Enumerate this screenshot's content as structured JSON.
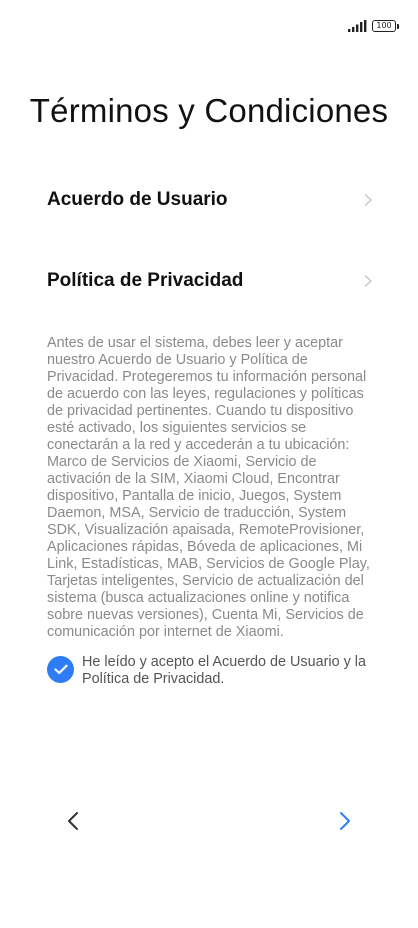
{
  "status_bar": {
    "signal_icon": "signal-bars-icon",
    "battery_level": "100",
    "battery_icon": "battery-icon"
  },
  "page": {
    "title": "Términos y Condiciones"
  },
  "links": [
    {
      "label": "Acuerdo de Usuario",
      "icon": "chevron-right-icon"
    },
    {
      "label": "Política de Privacidad",
      "icon": "chevron-right-icon"
    }
  ],
  "description": "Antes de usar el sistema, debes leer y aceptar nuestro Acuerdo de Usuario y Política de Privacidad. Protegeremos tu información personal de acuerdo con las leyes, regulaciones y políticas de privacidad pertinentes. Cuando tu dispositivo esté activado, los siguientes servicios se conectarán a la red y accederán a tu ubicación: Marco de Servicios de Xiaomi, Servicio de activación de la SIM, Xiaomi Cloud, Encontrar dispositivo, Pantalla de inicio, Juegos, System Daemon, MSA, Servicio de traducción, System SDK, Visualización apaisada, RemoteProvisioner, Aplicaciones rápidas, Bóveda de aplicaciones, Mi Link, Estadísticas, MAB, Servicios de Google Play, Tarjetas inteligentes, Servicio de actualización del sistema (busca actualizaciones online y notifica sobre nuevas versiones), Cuenta Mi, Servicios de comunicación por internet de Xiaomi.",
  "agreement": {
    "checked": true,
    "label": "He leído y acepto el Acuerdo de Usuario y la Política de Privacidad.",
    "check_color": "#2f7df6"
  },
  "navigation": {
    "back_icon": "chevron-left-icon",
    "next_icon": "chevron-right-icon",
    "next_color": "#2f7df6",
    "back_color": "#333333"
  }
}
